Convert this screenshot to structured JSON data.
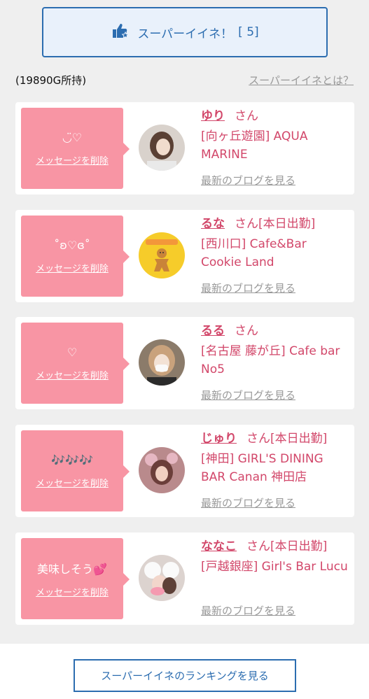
{
  "super_button": {
    "label": "スーパーイイネ！",
    "count": "[ 5]"
  },
  "gold_owned": "(19890G所持)",
  "about_link": "スーパーイイネとは？",
  "delete_label": "メッセージを削除",
  "blog_label": "最新のブログを見る",
  "san": "さん",
  "cards": [
    {
      "message": "◡̈♡",
      "name": "ゆり",
      "status": "",
      "shop": "[向ヶ丘遊園] AQUA MARINE"
    },
    {
      "message": "˚ʚ♡ɞ˚",
      "name": "るな",
      "status": "[本日出勤]",
      "shop": "[西川口] Cafe&Bar Cookie Land"
    },
    {
      "message": "♡",
      "name": "るる",
      "status": "",
      "shop": "[名古屋 藤が丘] Cafe bar No5"
    },
    {
      "message": "🎶🎶🎶",
      "name": "じゅり",
      "status": "[本日出勤]",
      "shop": "[神田] GIRL'S DINING BAR Canan 神田店"
    },
    {
      "message": "美味しそう💕",
      "name": "ななこ",
      "status": "[本日出勤]",
      "shop": "[戸越銀座] Girl's Bar Lucu"
    }
  ],
  "ranking_button": "スーパーイイネのランキングを見る",
  "colors": {
    "accent": "#2c6db0",
    "pink": "#f895a4",
    "name": "#d2476a"
  }
}
